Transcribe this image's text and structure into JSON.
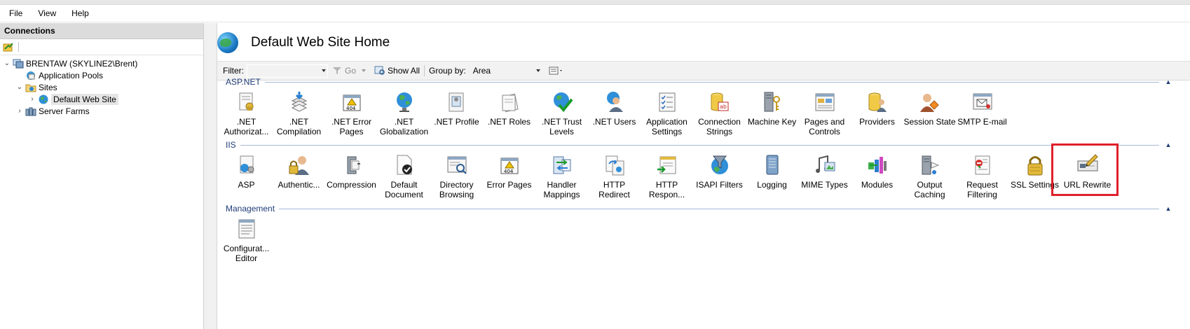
{
  "menubar": {
    "items": [
      "File",
      "View",
      "Help"
    ]
  },
  "connections": {
    "header": "Connections",
    "tree": [
      {
        "label": "BRENTAW (SKYLINE2\\Brent)",
        "icon": "server-icon"
      },
      {
        "label": "Application Pools",
        "icon": "app-pools-icon"
      },
      {
        "label": "Sites",
        "icon": "sites-folder-icon"
      },
      {
        "label": "Default Web Site",
        "icon": "globe-icon"
      },
      {
        "label": "Server Farms",
        "icon": "server-farms-icon"
      }
    ]
  },
  "main": {
    "title": "Default Web Site Home",
    "filter": {
      "label": "Filter:",
      "value": "",
      "go": "Go",
      "show_all": "Show All",
      "group_by_label": "Group by:",
      "group_by_value": "Area"
    },
    "sections": [
      {
        "name": "ASP.NET",
        "items": [
          {
            "label": ".NET Authorizat...",
            "icon": "net-authorization-icon"
          },
          {
            "label": ".NET Compilation",
            "icon": "net-compilation-icon"
          },
          {
            "label": ".NET Error Pages",
            "icon": "net-error-pages-icon"
          },
          {
            "label": ".NET Globalization",
            "icon": "net-globalization-icon"
          },
          {
            "label": ".NET Profile",
            "icon": "net-profile-icon"
          },
          {
            "label": ".NET Roles",
            "icon": "net-roles-icon"
          },
          {
            "label": ".NET Trust Levels",
            "icon": "net-trust-levels-icon"
          },
          {
            "label": ".NET Users",
            "icon": "net-users-icon"
          },
          {
            "label": "Application Settings",
            "icon": "application-settings-icon"
          },
          {
            "label": "Connection Strings",
            "icon": "connection-strings-icon"
          },
          {
            "label": "Machine Key",
            "icon": "machine-key-icon"
          },
          {
            "label": "Pages and Controls",
            "icon": "pages-controls-icon"
          },
          {
            "label": "Providers",
            "icon": "providers-icon"
          },
          {
            "label": "Session State",
            "icon": "session-state-icon"
          },
          {
            "label": "SMTP E-mail",
            "icon": "smtp-email-icon"
          }
        ]
      },
      {
        "name": "IIS",
        "items": [
          {
            "label": "ASP",
            "icon": "asp-icon"
          },
          {
            "label": "Authentic...",
            "icon": "authentication-icon"
          },
          {
            "label": "Compression",
            "icon": "compression-icon"
          },
          {
            "label": "Default Document",
            "icon": "default-document-icon"
          },
          {
            "label": "Directory Browsing",
            "icon": "directory-browsing-icon"
          },
          {
            "label": "Error Pages",
            "icon": "error-pages-icon"
          },
          {
            "label": "Handler Mappings",
            "icon": "handler-mappings-icon"
          },
          {
            "label": "HTTP Redirect",
            "icon": "http-redirect-icon"
          },
          {
            "label": "HTTP Respon...",
            "icon": "http-response-headers-icon"
          },
          {
            "label": "ISAPI Filters",
            "icon": "isapi-filters-icon"
          },
          {
            "label": "Logging",
            "icon": "logging-icon"
          },
          {
            "label": "MIME Types",
            "icon": "mime-types-icon"
          },
          {
            "label": "Modules",
            "icon": "modules-icon"
          },
          {
            "label": "Output Caching",
            "icon": "output-caching-icon"
          },
          {
            "label": "Request Filtering",
            "icon": "request-filtering-icon"
          },
          {
            "label": "SSL Settings",
            "icon": "ssl-settings-icon"
          },
          {
            "label": "URL Rewrite",
            "icon": "url-rewrite-icon"
          }
        ]
      },
      {
        "name": "Management",
        "items": [
          {
            "label": "Configurat... Editor",
            "icon": "configuration-editor-icon"
          }
        ]
      }
    ]
  },
  "highlight": {
    "target": "URL Rewrite",
    "color": "#e0202b"
  }
}
